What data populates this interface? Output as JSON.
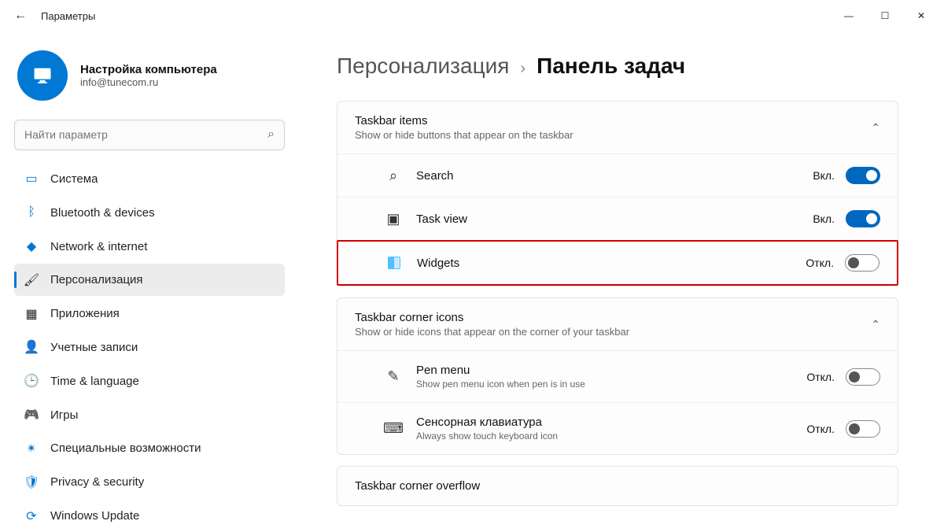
{
  "window": {
    "title": "Параметры"
  },
  "profile": {
    "name": "Настройка компьютера",
    "email": "info@tunecom.ru"
  },
  "search": {
    "placeholder": "Найти параметр"
  },
  "nav": [
    {
      "label": "Система",
      "icon": "system"
    },
    {
      "label": "Bluetooth & devices",
      "icon": "bluetooth"
    },
    {
      "label": "Network & internet",
      "icon": "network"
    },
    {
      "label": "Персонализация",
      "icon": "personalization",
      "selected": true
    },
    {
      "label": "Приложения",
      "icon": "apps"
    },
    {
      "label": "Учетные записи",
      "icon": "accounts"
    },
    {
      "label": "Time & language",
      "icon": "time"
    },
    {
      "label": "Игры",
      "icon": "gaming"
    },
    {
      "label": "Специальные возможности",
      "icon": "accessibility"
    },
    {
      "label": "Privacy & security",
      "icon": "privacy"
    },
    {
      "label": "Windows Update",
      "icon": "update"
    }
  ],
  "breadcrumb": {
    "parent": "Персонализация",
    "current": "Панель задач"
  },
  "sections": {
    "taskbarItems": {
      "title": "Taskbar items",
      "subtitle": "Show or hide buttons that appear on the taskbar",
      "rows": [
        {
          "label": "Search",
          "state": "Вкл.",
          "on": true,
          "icon": "search"
        },
        {
          "label": "Task view",
          "state": "Вкл.",
          "on": true,
          "icon": "taskview"
        },
        {
          "label": "Widgets",
          "state": "Откл.",
          "on": false,
          "icon": "widgets",
          "highlighted": true
        }
      ]
    },
    "cornerIcons": {
      "title": "Taskbar corner icons",
      "subtitle": "Show or hide icons that appear on the corner of your taskbar",
      "rows": [
        {
          "label": "Pen menu",
          "sub": "Show pen menu icon when pen is in use",
          "state": "Откл.",
          "on": false,
          "icon": "pen"
        },
        {
          "label": "Сенсорная клавиатура",
          "sub": "Always show touch keyboard icon",
          "state": "Откл.",
          "on": false,
          "icon": "keyboard"
        }
      ]
    },
    "cornerOverflow": {
      "title": "Taskbar corner overflow"
    }
  }
}
